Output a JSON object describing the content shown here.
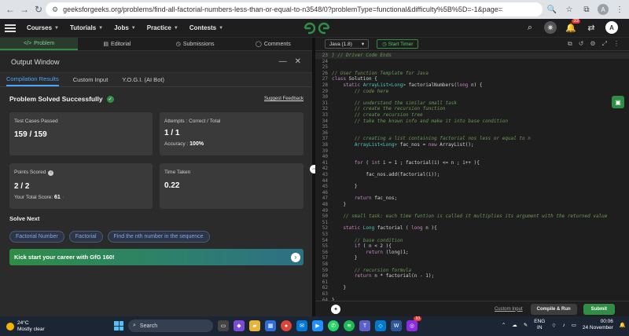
{
  "browser": {
    "url": "geeksforgeeks.org/problems/find-all-factorial-numbers-less-than-or-equal-to-n3548/0?problemType=functional&difficulty%5B%5D=-1&page=1&query=problemTypefunctionaldiffi...",
    "notification_count": "33",
    "profile_initial": "A"
  },
  "site_nav": {
    "logo": "GfG",
    "items": [
      "Courses",
      "Tutorials",
      "Jobs",
      "Practice",
      "Contests"
    ],
    "notif_count": "33",
    "user_initial": "A"
  },
  "problem_tabs": [
    "Problem",
    "Editorial",
    "Submissions",
    "Comments"
  ],
  "output_window": {
    "title": "Output Window",
    "tabs": [
      "Compilation Results",
      "Custom Input",
      "Y.O.G.I. (AI Bot)"
    ],
    "status": "Problem Solved Successfully",
    "feedback": "Suggest Feedback",
    "cards": {
      "test_cases_label": "Test Cases Passed",
      "test_cases_value": "159 / 159",
      "attempts_label": "Attempts : Correct / Total",
      "attempts_value": "1 / 1",
      "accuracy_label": "Accuracy :",
      "accuracy_value": "100%",
      "points_label": "Points Scored",
      "points_value": "2 / 2",
      "total_score_label": "Your Total Score:",
      "total_score_value": "61",
      "time_label": "Time Taken",
      "time_value": "0.22"
    },
    "solve_next_title": "Solve Next",
    "solve_next": [
      "Factorial Number",
      "Factorial",
      "Find the nth number in the sequence"
    ],
    "promo": "Kick start your career with GfG 160!"
  },
  "editor": {
    "language": "Java (1.8)",
    "timer": "Start Timer",
    "custom_input_link": "Custom Input",
    "compile_run": "Compile & Run",
    "submit": "Submit",
    "lines": [
      {
        "n": "23",
        "segs": [
          {
            "t": "} // Driver Code Ends",
            "c": "cmt"
          }
        ]
      },
      {
        "n": "24",
        "segs": []
      },
      {
        "n": "25",
        "segs": []
      },
      {
        "n": "26",
        "segs": [
          {
            "t": "// User function Template for Java",
            "c": "cmt"
          }
        ]
      },
      {
        "n": "27",
        "segs": [
          {
            "t": "class",
            "c": "kw"
          },
          {
            "t": " Solution {",
            "c": ""
          }
        ]
      },
      {
        "n": "28",
        "segs": [
          {
            "t": "    static ",
            "c": "kw"
          },
          {
            "t": "ArrayList<Long>",
            "c": "ty"
          },
          {
            "t": " factorialNumbers(",
            "c": ""
          },
          {
            "t": "long",
            "c": "kw"
          },
          {
            "t": " n) {",
            "c": ""
          }
        ]
      },
      {
        "n": "29",
        "segs": [
          {
            "t": "        // code here",
            "c": "cmt"
          }
        ]
      },
      {
        "n": "30",
        "segs": []
      },
      {
        "n": "31",
        "segs": [
          {
            "t": "        // understand the similar small task",
            "c": "cmt"
          }
        ]
      },
      {
        "n": "32",
        "segs": [
          {
            "t": "        // create the recursion function",
            "c": "cmt"
          }
        ]
      },
      {
        "n": "33",
        "segs": [
          {
            "t": "        // create recursion tree",
            "c": "cmt"
          }
        ]
      },
      {
        "n": "34",
        "segs": [
          {
            "t": "        // take the known info and make it into base condition",
            "c": "cmt"
          }
        ]
      },
      {
        "n": "35",
        "segs": []
      },
      {
        "n": "36",
        "segs": []
      },
      {
        "n": "37",
        "segs": [
          {
            "t": "        // creating a list containing factorial nos less or equal to n",
            "c": "cmt"
          }
        ]
      },
      {
        "n": "38",
        "segs": [
          {
            "t": "        ArrayList<Long>",
            "c": "ty"
          },
          {
            "t": " fac_nos = ",
            "c": ""
          },
          {
            "t": "new",
            "c": "kw"
          },
          {
            "t": " ArrayList();",
            "c": ""
          }
        ]
      },
      {
        "n": "39",
        "segs": []
      },
      {
        "n": "40",
        "segs": []
      },
      {
        "n": "41",
        "segs": [
          {
            "t": "        ",
            "c": ""
          },
          {
            "t": "for",
            "c": "kw"
          },
          {
            "t": " ( ",
            "c": ""
          },
          {
            "t": "int",
            "c": "kw"
          },
          {
            "t": " i = 1 ; factorial(i) <= n ; i++ ){",
            "c": ""
          }
        ]
      },
      {
        "n": "42",
        "segs": []
      },
      {
        "n": "43",
        "segs": [
          {
            "t": "            fac_nos.add(factorial(i));",
            "c": ""
          }
        ]
      },
      {
        "n": "44",
        "segs": []
      },
      {
        "n": "45",
        "segs": [
          {
            "t": "        }",
            "c": ""
          }
        ]
      },
      {
        "n": "46",
        "segs": []
      },
      {
        "n": "47",
        "segs": [
          {
            "t": "        ",
            "c": ""
          },
          {
            "t": "return",
            "c": "kw"
          },
          {
            "t": " fac_nos;",
            "c": ""
          }
        ]
      },
      {
        "n": "48",
        "segs": [
          {
            "t": "    }",
            "c": ""
          }
        ]
      },
      {
        "n": "49",
        "segs": []
      },
      {
        "n": "50",
        "segs": [
          {
            "t": "    // small task: each time funtion is called it multiplies its argument with the returned value",
            "c": "cmt"
          }
        ]
      },
      {
        "n": "51",
        "segs": []
      },
      {
        "n": "52",
        "segs": [
          {
            "t": "    static ",
            "c": "kw"
          },
          {
            "t": "Long",
            "c": "ty"
          },
          {
            "t": " factorial ( ",
            "c": ""
          },
          {
            "t": "long",
            "c": "kw"
          },
          {
            "t": " n ){",
            "c": ""
          }
        ]
      },
      {
        "n": "53",
        "segs": []
      },
      {
        "n": "54",
        "segs": [
          {
            "t": "        // base condition",
            "c": "cmt"
          }
        ]
      },
      {
        "n": "55",
        "segs": [
          {
            "t": "        ",
            "c": ""
          },
          {
            "t": "if",
            "c": "kw"
          },
          {
            "t": " ( n < 2 ){",
            "c": ""
          }
        ]
      },
      {
        "n": "56",
        "segs": [
          {
            "t": "            ",
            "c": ""
          },
          {
            "t": "return",
            "c": "kw"
          },
          {
            "t": " (long)1;",
            "c": ""
          }
        ]
      },
      {
        "n": "57",
        "segs": [
          {
            "t": "        }",
            "c": ""
          }
        ]
      },
      {
        "n": "58",
        "segs": []
      },
      {
        "n": "59",
        "segs": [
          {
            "t": "        // recursion formula",
            "c": "cmt"
          }
        ]
      },
      {
        "n": "60",
        "segs": [
          {
            "t": "        ",
            "c": ""
          },
          {
            "t": "return",
            "c": "kw"
          },
          {
            "t": " n * factorial(n - 1);",
            "c": ""
          }
        ]
      },
      {
        "n": "61",
        "segs": []
      },
      {
        "n": "62",
        "segs": [
          {
            "t": "    }",
            "c": ""
          }
        ]
      },
      {
        "n": "63",
        "segs": []
      },
      {
        "n": "64",
        "segs": [
          {
            "t": "}",
            "c": ""
          }
        ]
      }
    ]
  },
  "taskbar": {
    "temperature": "24°C",
    "weather": "Mostly clear",
    "search_placeholder": "Search",
    "lang_top": "ENG",
    "lang_bottom": "IN",
    "time": "00:06",
    "date": "24 November",
    "badge": "10"
  }
}
